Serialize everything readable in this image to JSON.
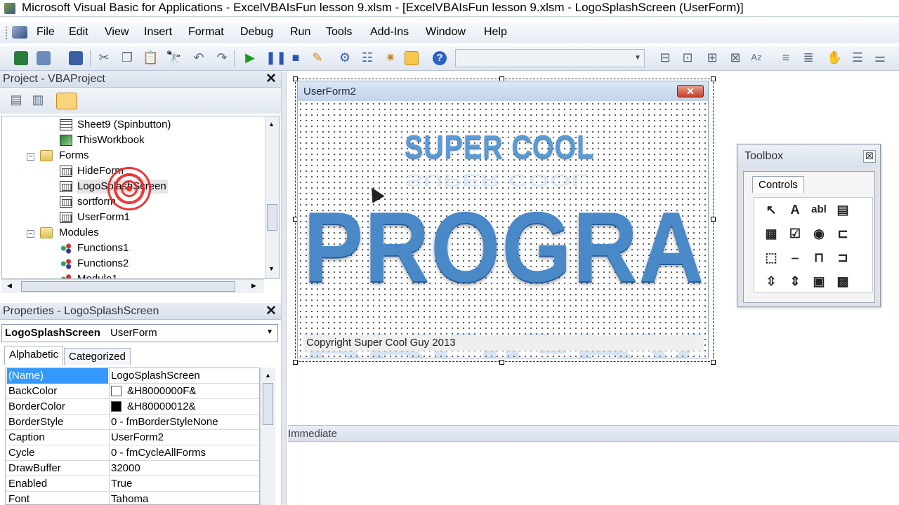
{
  "window": {
    "title": "Microsoft Visual Basic for Applications - ExcelVBAIsFun lesson 9.xlsm - [ExcelVBAIsFun lesson 9.xlsm - LogoSplashScreen (UserForm)]"
  },
  "menu": [
    "File",
    "Edit",
    "View",
    "Insert",
    "Format",
    "Debug",
    "Run",
    "Tools",
    "Add-Ins",
    "Window",
    "Help"
  ],
  "project": {
    "title": "Project - VBAProject",
    "tree": [
      {
        "label": "Sheet9 (Spinbutton)",
        "icon": "sheet-icon"
      },
      {
        "label": "ThisWorkbook",
        "icon": "workbook-icon"
      },
      {
        "label": "Forms",
        "icon": "folder-icon"
      },
      {
        "label": "HideForm",
        "icon": "form-icon"
      },
      {
        "label": "LogoSplashScreen",
        "icon": "form-icon"
      },
      {
        "label": "sortform",
        "icon": "form-icon"
      },
      {
        "label": "UserForm1",
        "icon": "form-icon"
      },
      {
        "label": "Modules",
        "icon": "folder-icon"
      },
      {
        "label": "Functions1",
        "icon": "module-icon"
      },
      {
        "label": "Functions2",
        "icon": "module-icon"
      },
      {
        "label": "Module1",
        "icon": "module-icon"
      }
    ]
  },
  "properties": {
    "title": "Properties - LogoSplashScreen",
    "object_name": "LogoSplashScreen",
    "object_type": "UserForm",
    "tabs": [
      "Alphabetic",
      "Categorized"
    ],
    "rows": [
      {
        "name": "(Name)",
        "value": "LogoSplashScreen"
      },
      {
        "name": "BackColor",
        "value": "&H8000000F&",
        "swatch": "#ffffff"
      },
      {
        "name": "BorderColor",
        "value": "&H80000012&",
        "swatch": "#000000"
      },
      {
        "name": "BorderStyle",
        "value": "0 - fmBorderStyleNone"
      },
      {
        "name": "Caption",
        "value": "UserForm2"
      },
      {
        "name": "Cycle",
        "value": "0 - fmCycleAllForms"
      },
      {
        "name": "DrawBuffer",
        "value": "32000"
      },
      {
        "name": "Enabled",
        "value": "True"
      },
      {
        "name": "Font",
        "value": "Tahoma"
      }
    ]
  },
  "userform": {
    "caption": "UserForm2",
    "close_glyph": "✕",
    "logo_top": "SUPER COOL",
    "logo_main": "PROGRAM",
    "copyright": "Copyright Super Cool Guy 2013"
  },
  "toolbox": {
    "title": "Toolbox",
    "close_glyph": "☒",
    "tab": "Controls",
    "tools": [
      "↖",
      "A",
      "abl",
      "▤",
      "▦",
      "☑",
      "◉",
      "⊏",
      "⬚",
      "⎯",
      "⊓",
      "⊐",
      "⇳",
      "⇕",
      "▣",
      "▩"
    ]
  },
  "immediate": {
    "title": "Immediate"
  },
  "colors": {
    "accent": "#3399ff",
    "logo_blue": "#4a89c8",
    "closebtn": "#c7422a"
  }
}
